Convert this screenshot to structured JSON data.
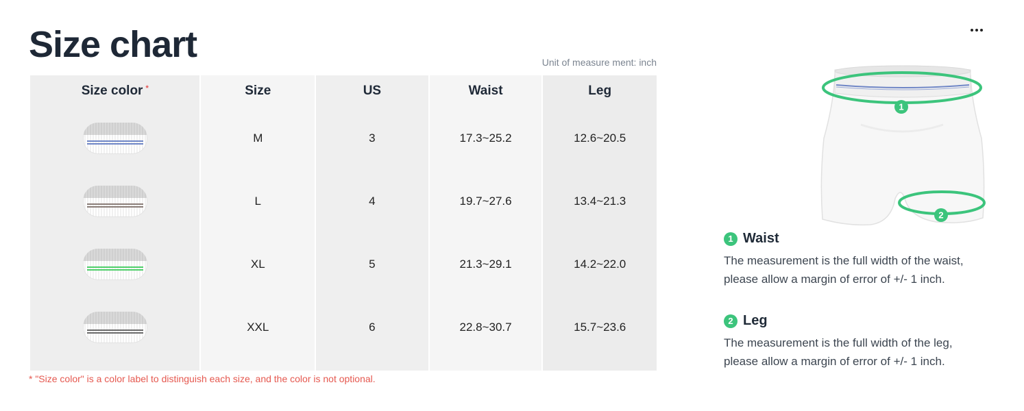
{
  "title": "Size chart",
  "unit_note": "Unit of measure ment: inch",
  "table": {
    "headers": {
      "size_color": "Size color",
      "required_mark": "*",
      "size": "Size",
      "us": "US",
      "waist": "Waist",
      "leg": "Leg"
    },
    "rows": [
      {
        "size": "M",
        "us": "3",
        "waist": "17.3~25.2",
        "leg": "12.6~20.5",
        "color": "#6f86c6"
      },
      {
        "size": "L",
        "us": "4",
        "waist": "19.7~27.6",
        "leg": "13.4~21.3",
        "color": "#8a7d78"
      },
      {
        "size": "XL",
        "us": "5",
        "waist": "21.3~29.1",
        "leg": "14.2~22.0",
        "color": "#4fcf6a"
      },
      {
        "size": "XXL",
        "us": "6",
        "waist": "22.8~30.7",
        "leg": "15.7~23.6",
        "color": "#6b6b6b"
      }
    ]
  },
  "footnote": "* \"Size color\" is a color label to distinguish each size, and the color is not optional.",
  "diagram": {
    "marker_1": "1",
    "marker_2": "2",
    "accent": "#3cc47c"
  },
  "measurements": [
    {
      "number": "1",
      "label": "Waist",
      "line1": "The measurement is the full width of the waist,",
      "line2": "please allow a margin of error of +/- 1 inch."
    },
    {
      "number": "2",
      "label": "Leg",
      "line1": "The measurement is the full width of the leg,",
      "line2": "please allow a margin of error of +/- 1 inch."
    }
  ],
  "icons": {
    "more": "more-horizontal-icon"
  }
}
